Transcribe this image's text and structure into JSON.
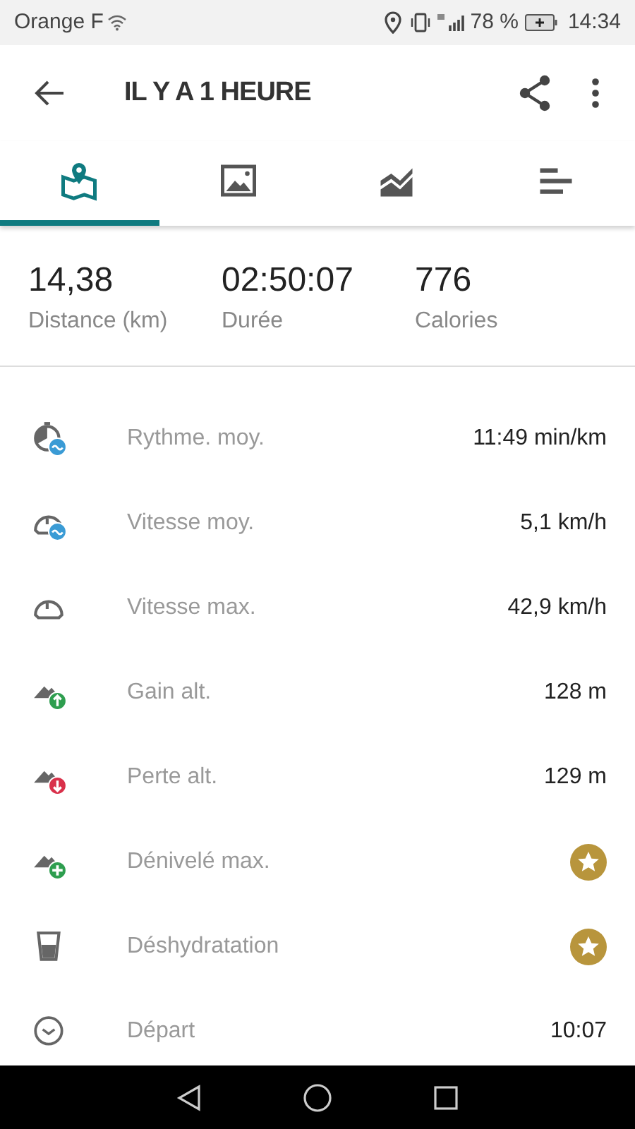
{
  "status_bar": {
    "carrier": "Orange F",
    "battery": "78 %",
    "time": "14:34"
  },
  "toolbar": {
    "title": "IL Y A 1 HEURE"
  },
  "tabs": [
    {
      "kind": "map",
      "selected": true
    },
    {
      "kind": "photos",
      "selected": false
    },
    {
      "kind": "chart",
      "selected": false
    },
    {
      "kind": "list",
      "selected": false
    }
  ],
  "stats": [
    {
      "value": "14,38",
      "label": "Distance (km)"
    },
    {
      "value": "02:50:07",
      "label": "Durée"
    },
    {
      "value": "776",
      "label": "Calories"
    }
  ],
  "rows": [
    {
      "label": "Rythme. moy.",
      "kind": "value",
      "value": "11:49 min/km"
    },
    {
      "label": "Vitesse moy.",
      "kind": "value",
      "value": "5,1 km/h"
    },
    {
      "label": "Vitesse max.",
      "kind": "value",
      "value": "42,9 km/h"
    },
    {
      "label": "Gain alt.",
      "kind": "value",
      "value": "128 m"
    },
    {
      "label": "Perte alt.",
      "kind": "value",
      "value": "129 m"
    },
    {
      "label": "Dénivelé max.",
      "kind": "premium"
    },
    {
      "label": "Déshydratation",
      "kind": "premium"
    },
    {
      "label": "Départ",
      "kind": "value",
      "value": "10:07"
    }
  ]
}
